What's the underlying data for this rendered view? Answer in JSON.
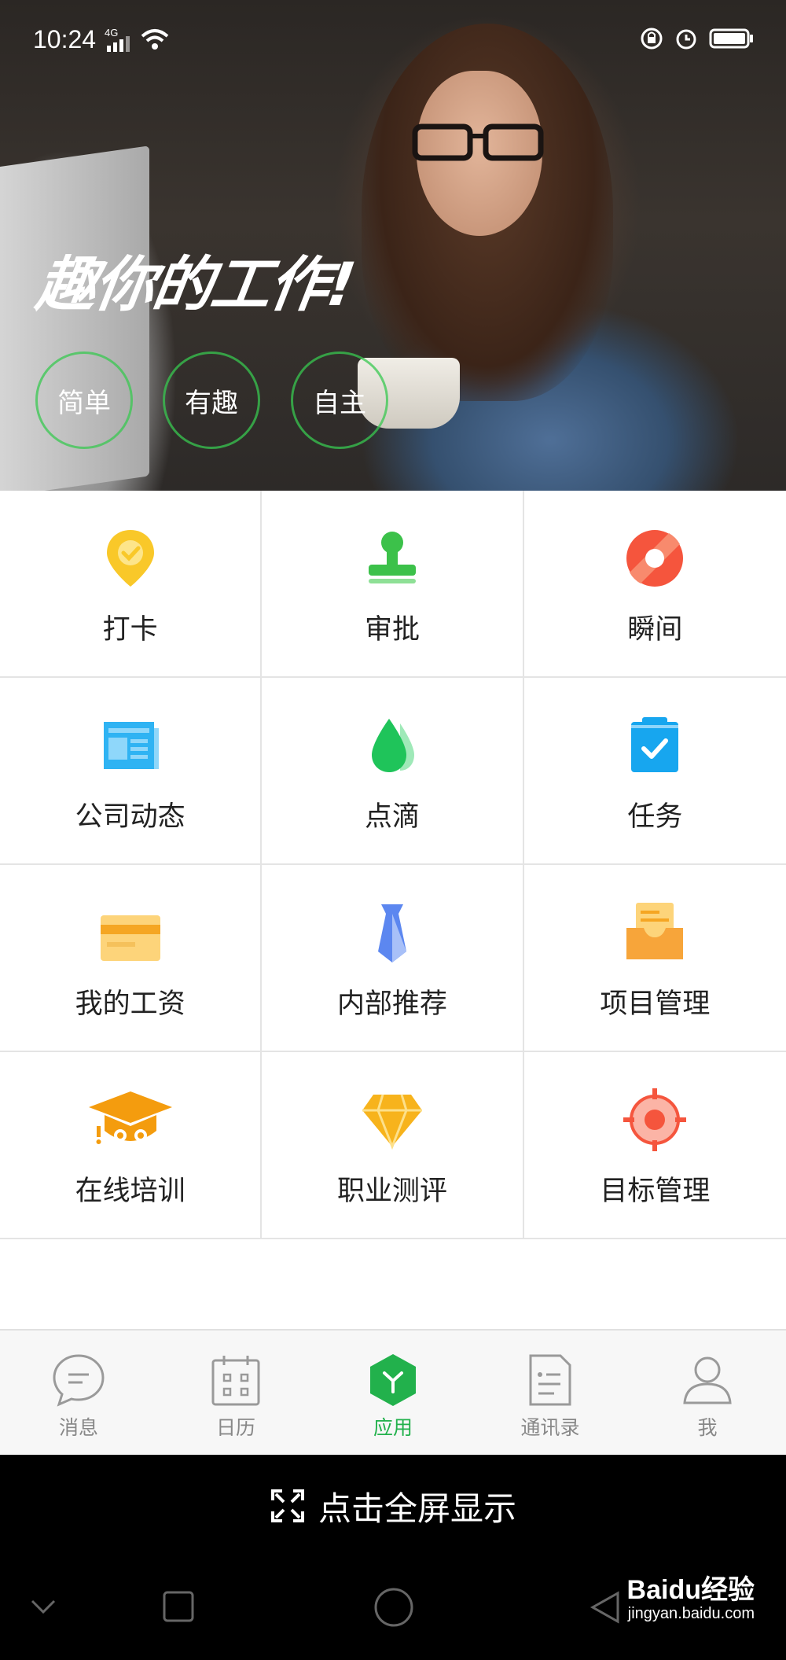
{
  "status_bar": {
    "time": "10:24",
    "network": "4G"
  },
  "banner": {
    "slogan": "趣你的工作!",
    "tags": [
      "简单",
      "有趣",
      "自主"
    ]
  },
  "apps": [
    {
      "label": "打卡",
      "icon": "location-check-icon",
      "color": "#f9c829"
    },
    {
      "label": "审批",
      "icon": "stamp-icon",
      "color": "#3cc14a"
    },
    {
      "label": "瞬间",
      "icon": "moment-icon",
      "color": "#f5553d"
    },
    {
      "label": "公司动态",
      "icon": "newspaper-icon",
      "color": "#2fb3f3"
    },
    {
      "label": "点滴",
      "icon": "droplet-icon",
      "color": "#1fc45a"
    },
    {
      "label": "任务",
      "icon": "clipboard-check-icon",
      "color": "#17a6ef"
    },
    {
      "label": "我的工资",
      "icon": "salary-card-icon",
      "color": "#f7b23b"
    },
    {
      "label": "内部推荐",
      "icon": "necktie-icon",
      "color": "#5c87f0"
    },
    {
      "label": "项目管理",
      "icon": "folder-inbox-icon",
      "color": "#f7a53a"
    },
    {
      "label": "在线培训",
      "icon": "graduation-cap-icon",
      "color": "#f49c0e"
    },
    {
      "label": "职业测评",
      "icon": "diamond-icon",
      "color": "#f7b31c"
    },
    {
      "label": "目标管理",
      "icon": "target-icon",
      "color": "#f5553d"
    }
  ],
  "tabs": [
    {
      "label": "消息",
      "icon": "chat-bubble-icon",
      "active": false
    },
    {
      "label": "日历",
      "icon": "calendar-icon",
      "active": false
    },
    {
      "label": "应用",
      "icon": "apps-cube-icon",
      "active": true
    },
    {
      "label": "通讯录",
      "icon": "contacts-icon",
      "active": false
    },
    {
      "label": "我",
      "icon": "person-icon",
      "active": false
    }
  ],
  "fullscreen_label": "点击全屏显示",
  "watermark": {
    "main": "Baidu经验",
    "sub": "jingyan.baidu.com"
  },
  "colors": {
    "accent": "#22b14c",
    "inactive": "#888888"
  }
}
